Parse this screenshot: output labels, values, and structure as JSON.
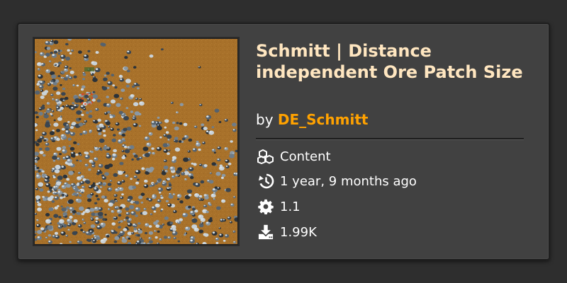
{
  "mod": {
    "title": "Schmitt | Distance independent Ore Patch Size",
    "by_label": "by",
    "author": "DE_Schmitt",
    "thumbnail_alt": "ore patch screenshot"
  },
  "meta": {
    "category": "Content",
    "updated": "1 year, 9 months ago",
    "version": "1.1",
    "downloads": "1.99K"
  },
  "icons": {
    "category": "cubes-icon",
    "updated": "history-icon",
    "version": "gear-icon",
    "downloads": "download-icon"
  },
  "colors": {
    "title": "#ffe6c0",
    "author": "#ffa200",
    "card_bg": "#414141",
    "ground": "#a8712a"
  }
}
